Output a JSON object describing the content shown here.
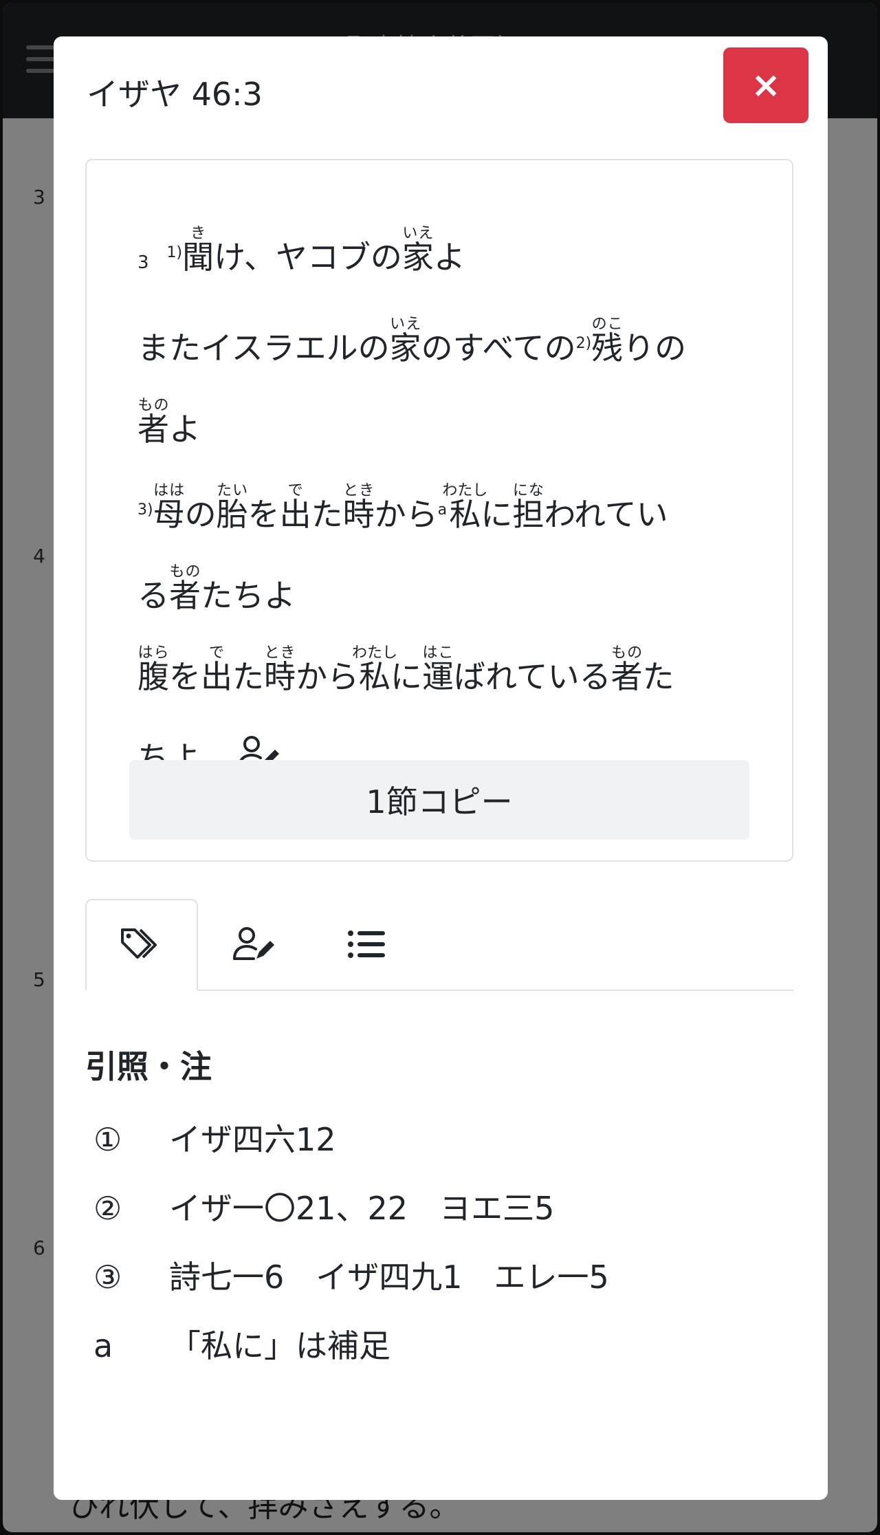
{
  "background": {
    "nav_title": "聖書協会共同訳",
    "verse_numbers": [
      "3",
      "4",
      "5",
      "6"
    ],
    "tail_text": "ひれ伏して、拝みさえする。"
  },
  "modal": {
    "title": "イザヤ 46:3",
    "close_label": "×",
    "verse": {
      "number": "3",
      "fn1": "1)",
      "fn2": "2)",
      "fn3": "3)",
      "fna": "a",
      "l1a": "聞",
      "l1a_rt": "き",
      "l1b": "け、ヤコブの",
      "l1c": "家",
      "l1c_rt": "いえ",
      "l1d": "よ",
      "l2a": "またイスラエルの",
      "l2b": "家",
      "l2b_rt": "いえ",
      "l2c": "のすべての",
      "l2d": "残",
      "l2d_rt": "のこ",
      "l2e": "りの",
      "l3a": "者",
      "l3a_rt": "もの",
      "l3b": "よ",
      "l4a": "母",
      "l4a_rt": "はは",
      "l4b": "の",
      "l4c": "胎",
      "l4c_rt": "たい",
      "l4d": "を",
      "l4e": "出",
      "l4e_rt": "で",
      "l4f": "た",
      "l4g": "時",
      "l4g_rt": "とき",
      "l4h": "から",
      "l4i": "私",
      "l4i_rt": "わたし",
      "l4j": "に",
      "l4k": "担",
      "l4k_rt": "にな",
      "l4l": "われてい",
      "l5a": "る",
      "l5b": "者",
      "l5b_rt": "もの",
      "l5c": "たちよ",
      "l6a": "腹",
      "l6a_rt": "はら",
      "l6b": "を",
      "l6c": "出",
      "l6c_rt": "で",
      "l6d": "た",
      "l6e": "時",
      "l6e_rt": "とき",
      "l6f": "から",
      "l6g": "私",
      "l6g_rt": "わたし",
      "l6h": "に",
      "l6i": "運",
      "l6i_rt": "はこ",
      "l6j": "ばれている",
      "l6k": "者",
      "l6k_rt": "もの",
      "l6l": "た",
      "l7a": "ちよ。"
    },
    "copy_button": "1節コピー",
    "tabs": [
      {
        "icon": "tags-icon"
      },
      {
        "icon": "person-pen-icon"
      },
      {
        "icon": "list-icon"
      }
    ],
    "refs_heading": "引照・注",
    "refs": [
      {
        "mark": "①",
        "text": "イザ四六12"
      },
      {
        "mark": "②",
        "text": "イザ一〇21、22　ヨエ三5"
      },
      {
        "mark": "③",
        "text": "詩七一6　イザ四九1　エレ一5"
      },
      {
        "mark": "a",
        "text": "「私に」は補足"
      }
    ]
  },
  "colors": {
    "close_button": "#dc3545",
    "navbar": "#212529",
    "text": "#212529",
    "copy_button_bg": "#f1f2f3"
  }
}
